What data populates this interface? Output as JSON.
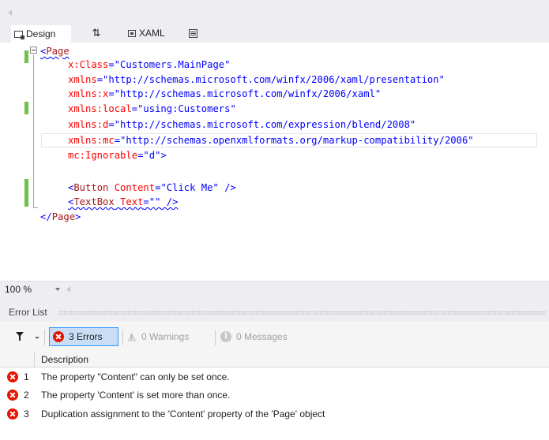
{
  "tabs": {
    "design": "Design",
    "swap": "⇅",
    "xaml": "XAML"
  },
  "code": {
    "line1": {
      "open": "<",
      "tag": "Page"
    },
    "line2": {
      "attr": "x:Class",
      "eq": "=",
      "val": "\"Customers.MainPage\""
    },
    "line3": {
      "attr": "xmlns",
      "eq": "=",
      "val": "\"http://schemas.microsoft.com/winfx/2006/xaml/presentation\""
    },
    "line4": {
      "attr": "xmlns:x",
      "eq": "=",
      "val": "\"http://schemas.microsoft.com/winfx/2006/xaml\""
    },
    "line5": {
      "attr": "xmlns:local",
      "eq": "=",
      "val": "\"using:Customers\""
    },
    "line6": {
      "attr": "xmlns:d",
      "eq": "=",
      "val": "\"http://schemas.microsoft.com/expression/blend/2008\""
    },
    "line7": {
      "attr": "xmlns:mc",
      "eq": "=",
      "val": "\"http://schemas.openxmlformats.org/markup-compatibility/2006\""
    },
    "line8": {
      "attr": "mc:Ignorable",
      "eq": "=",
      "val": "\"d\"",
      "close": ">"
    },
    "line10": {
      "open": "<",
      "tag": "Button",
      "attr": "Content",
      "eq": "=",
      "val": "\"Click Me\"",
      "close": " />"
    },
    "line11": {
      "open": "<",
      "tag": "TextBox",
      "attr": "Text",
      "eq": "=",
      "val": "\"\"",
      "close": " />"
    },
    "line12": {
      "open": "</",
      "tag": "Page",
      "close": ">"
    }
  },
  "zoom": {
    "value": "100 %"
  },
  "error_list": {
    "title": "Error List",
    "errors_button": "3 Errors",
    "warnings_button": "0 Warnings",
    "messages_button": "0 Messages",
    "column_description": "Description",
    "rows": [
      {
        "num": "1",
        "description": "The property \"Content\" can only be set once."
      },
      {
        "num": "2",
        "description": "The property 'Content' is set more than once."
      },
      {
        "num": "3",
        "description": "Duplication assignment to the 'Content' property of the 'Page' object"
      }
    ]
  },
  "colors": {
    "keyword_blue": "#0000ff",
    "tag_maroon": "#a31515",
    "attr_red": "#ff0000",
    "change_bar_green": "#6cc24a",
    "error_red": "#e51400",
    "selection_blue": "#c9def5"
  },
  "icons": [
    "design-view-icon",
    "swap-panes-icon",
    "xaml-view-icon",
    "toggle-pane-icon",
    "collapse-icon",
    "filter-icon",
    "error-icon",
    "warning-icon",
    "info-icon"
  ]
}
